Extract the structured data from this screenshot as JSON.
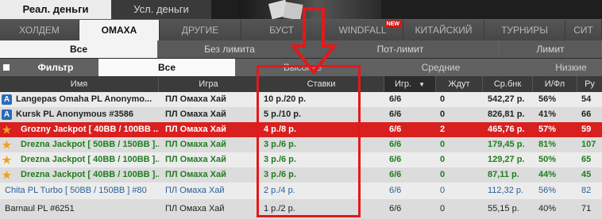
{
  "money_tabs": [
    {
      "label": "Реал. деньги",
      "active": true
    },
    {
      "label": "Усл. деньги",
      "active": false
    }
  ],
  "game_tabs": [
    {
      "label": "ХОЛДЕМ",
      "active": false
    },
    {
      "label": "ОМАХА",
      "active": true
    },
    {
      "label": "ДРУГИЕ",
      "active": false
    },
    {
      "label": "БУСТ",
      "active": false
    },
    {
      "label": "WINDFALL",
      "active": false,
      "badge": "NEW"
    },
    {
      "label": "КИТАЙСКИЙ",
      "active": false
    },
    {
      "label": "ТУРНИРЫ",
      "active": false
    },
    {
      "label": "СИТ",
      "active": false
    }
  ],
  "limit_tabs": [
    {
      "label": "Все",
      "active": true
    },
    {
      "label": "Без лимита",
      "active": false
    },
    {
      "label": "Пот-лимит",
      "active": false
    },
    {
      "label": "Лимит",
      "active": false
    }
  ],
  "filter": {
    "label": "Фильтр",
    "all": "Все",
    "high": "Высокие",
    "medium": "Средние",
    "low": "Низкие"
  },
  "columns": {
    "name": "Имя",
    "game": "Игра",
    "stakes": "Ставки",
    "players": "Игр.",
    "waiting": "Ждут",
    "avg_pot": "Ср.бнк",
    "flop": "И/Фл",
    "hands": "Ру"
  },
  "rows": [
    {
      "icon": "A",
      "name": "Langepas Omaha PL Anonymo...",
      "game": "ПЛ Омаха Хай",
      "stakes": "10 р./20 р.",
      "players": "6/6",
      "waiting": "0",
      "avg_pot": "542,27 р.",
      "flop": "56%",
      "hands": "54"
    },
    {
      "icon": "A",
      "name": "Kursk PL Anonymous #3586",
      "game": "ПЛ Омаха Хай",
      "stakes": "5 р./10 р.",
      "players": "6/6",
      "waiting": "0",
      "avg_pot": "826,81 р.",
      "flop": "41%",
      "hands": "66"
    },
    {
      "icon": "★",
      "name": "Grozny Jackpot [ 40BB / 100BB ...",
      "game": "ПЛ Омаха Хай",
      "stakes": "4 р./8 р.",
      "players": "6/6",
      "waiting": "2",
      "avg_pot": "465,76 р.",
      "flop": "57%",
      "hands": "59"
    },
    {
      "icon": "★",
      "name": "Drezna Jackpot [ 50BB / 150BB ]...",
      "game": "ПЛ Омаха Хай",
      "stakes": "3 р./6 р.",
      "players": "6/6",
      "waiting": "0",
      "avg_pot": "179,45 р.",
      "flop": "81%",
      "hands": "107"
    },
    {
      "icon": "★",
      "name": "Drezna Jackpot [ 40BB / 100BB ]...",
      "game": "ПЛ Омаха Хай",
      "stakes": "3 р./6 р.",
      "players": "6/6",
      "waiting": "0",
      "avg_pot": "129,27 р.",
      "flop": "50%",
      "hands": "65"
    },
    {
      "icon": "★",
      "name": "Drezna Jackpot [ 40BB / 100BB ]...",
      "game": "ПЛ Омаха Хай",
      "stakes": "3 р./6 р.",
      "players": "6/6",
      "waiting": "0",
      "avg_pot": "87,11 р.",
      "flop": "44%",
      "hands": "45"
    },
    {
      "icon": "",
      "name": "Chita PL Turbo [ 50BB / 150BB ] #80",
      "game": "ПЛ Омаха Хай",
      "stakes": "2 р./4 р.",
      "players": "6/6",
      "waiting": "0",
      "avg_pot": "112,32 р.",
      "flop": "56%",
      "hands": "82"
    },
    {
      "icon": "",
      "name": "Barnaul PL  #6251",
      "game": "ПЛ Омаха Хай",
      "stakes": "1 р./2 р.",
      "players": "6/6",
      "waiting": "0",
      "avg_pot": "55,15 р.",
      "flop": "40%",
      "hands": "71"
    }
  ],
  "colors": {
    "selected_row": "#d8201f",
    "highlight": "#e2191b",
    "jackpot_text": "#1f7d1f",
    "turbo_text": "#2a5f9a"
  }
}
